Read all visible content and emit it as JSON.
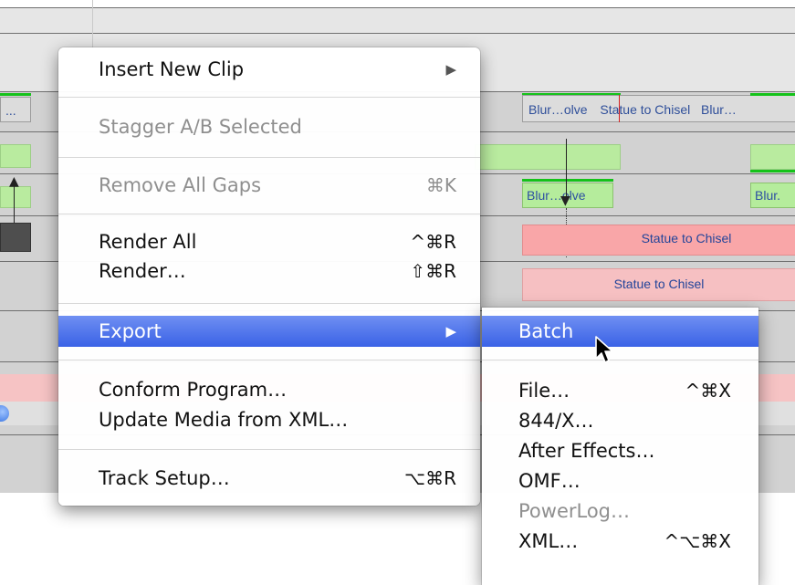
{
  "timeline": {
    "clips": {
      "gray_top": "...",
      "blur_dissolve_top": "Blur…olve",
      "statue_to_chisel_top": "Statue to Chisel",
      "blur_top_right": "Blur…",
      "blur_dissolve_green": "Blur…olve",
      "blur_green_right": "Blur.",
      "statue_to_chisel_pink": "Statue to Chisel",
      "statue_to_chisel_pink2": "Statue to Chisel"
    }
  },
  "main_menu": {
    "items": [
      {
        "label": "Insert New Clip",
        "shortcut": "",
        "submenu": true,
        "disabled": false
      },
      {
        "label": "Stagger A/B Selected",
        "shortcut": "",
        "submenu": false,
        "disabled": true
      },
      {
        "label": "Remove All Gaps",
        "shortcut": "⌘K",
        "submenu": false,
        "disabled": true
      },
      {
        "label": "Render All",
        "shortcut": "^⌘R",
        "submenu": false,
        "disabled": false
      },
      {
        "label": "Render…",
        "shortcut": "⇧⌘R",
        "submenu": false,
        "disabled": false
      },
      {
        "label": "Export",
        "shortcut": "",
        "submenu": true,
        "disabled": false,
        "selected": true
      },
      {
        "label": "Conform Program…",
        "shortcut": "",
        "submenu": false,
        "disabled": false
      },
      {
        "label": "Update Media from XML…",
        "shortcut": "",
        "submenu": false,
        "disabled": false
      },
      {
        "label": "Track Setup…",
        "shortcut": "⌥⌘R",
        "submenu": false,
        "disabled": false
      }
    ],
    "submenu_arrow": "▶"
  },
  "export_submenu": {
    "items": [
      {
        "label": "Batch",
        "shortcut": "",
        "selected": true,
        "disabled": false
      },
      {
        "label": "File…",
        "shortcut": "^⌘X",
        "disabled": false
      },
      {
        "label": "844/X…",
        "shortcut": "",
        "disabled": false
      },
      {
        "label": "After Effects…",
        "shortcut": "",
        "disabled": false
      },
      {
        "label": "OMF…",
        "shortcut": "",
        "disabled": false
      },
      {
        "label": "PowerLog…",
        "shortcut": "",
        "disabled": true
      },
      {
        "label": "XML…",
        "shortcut": "^⌥⌘X",
        "disabled": false
      }
    ]
  },
  "colors": {
    "selection": "#3a62e6",
    "clip_green": "#b9eb9f",
    "clip_pink": "#f9a6a8",
    "clip_label": "#2d4fa2"
  }
}
